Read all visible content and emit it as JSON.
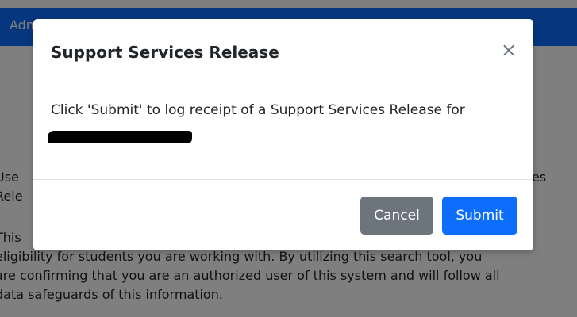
{
  "app": {
    "title": "Admin"
  },
  "background": {
    "para1_line1_start": "Use",
    "para1_line1_end": "es",
    "para1_line2": "Rele",
    "para2_lines": [
      "This",
      "eligibility for students you are working with. By utilizing this search tool, you",
      "are confirming that you are an authorized user of this system and will follow all",
      "data safeguards of this information."
    ]
  },
  "modal": {
    "title": "Support Services Release",
    "close_label": "×",
    "body_text": "Click 'Submit' to log receipt of a Support Services Release for",
    "cancel_label": "Cancel",
    "submit_label": "Submit"
  },
  "colors": {
    "primary": "#0d6efd",
    "secondary": "#6c757d"
  }
}
